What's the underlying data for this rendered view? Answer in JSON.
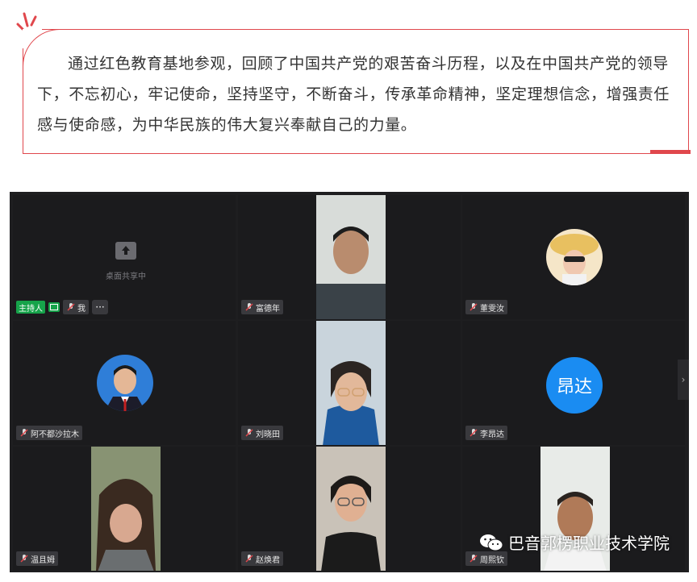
{
  "article": {
    "text": "通过红色教育基地参观，回顾了中国共产党的艰苦奋斗历程，以及在中国共产党的领导下，不忘初心，牢记使命，坚持坚守，不断奋斗，传承革命精神，坚定理想信念，增强责任感与使命感，为中华民族的伟大复兴奉献自己的力量。"
  },
  "colors": {
    "accent": "#e0474c",
    "meeting_bg": "#1e1e20",
    "host_green": "#16a34a",
    "avatar_blue": "#1a8cf2"
  },
  "meeting": {
    "tiles": [
      {
        "name": "我",
        "host_label": "主持人",
        "screen_share_text": "桌面共享中",
        "more": "···"
      },
      {
        "name": "富德年"
      },
      {
        "name": "董雯汝"
      },
      {
        "name": "阿不都沙拉木"
      },
      {
        "name": "刘晓田"
      },
      {
        "name": "李昂达",
        "avatar_text": "昂达"
      },
      {
        "name": "温且姆"
      },
      {
        "name": "赵焕君"
      },
      {
        "name": "周熙钦"
      }
    ],
    "next_page": "›"
  },
  "watermark": {
    "text": "巴音郭楞职业技术学院",
    "icon": "wechat-icon"
  }
}
